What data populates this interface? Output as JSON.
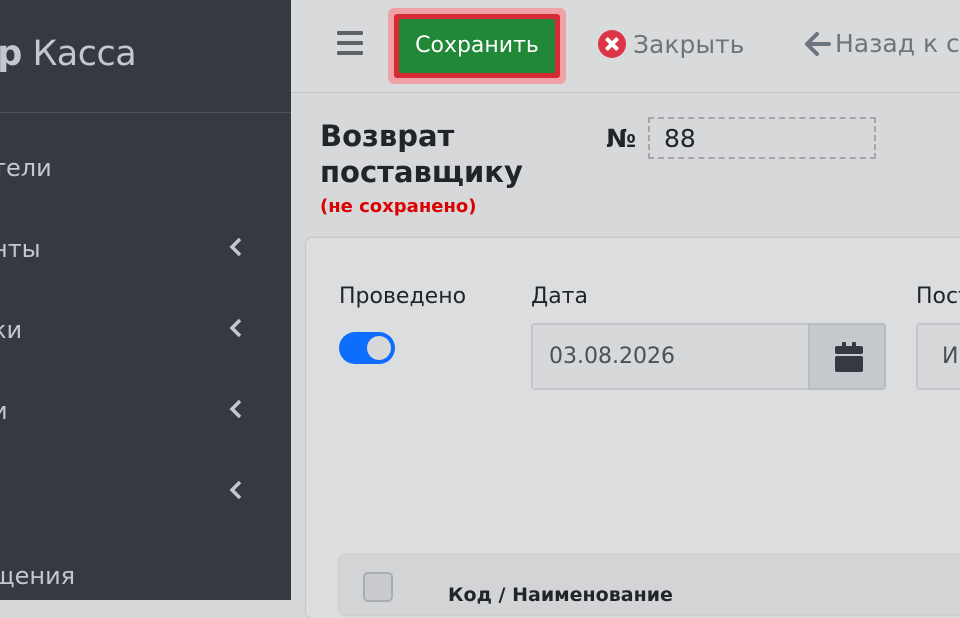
{
  "sidebar": {
    "brand_bold": "ер",
    "brand_light": "Касса",
    "items": [
      {
        "label": "тели",
        "has_arrow": false
      },
      {
        "label": "нты",
        "has_arrow": true
      },
      {
        "label": "ки",
        "has_arrow": true
      },
      {
        "label": "и",
        "has_arrow": true
      },
      {
        "label": "",
        "has_arrow": true
      },
      {
        "label": "щения",
        "has_arrow": false
      }
    ]
  },
  "toolbar": {
    "menu_icon": "hamburger-icon",
    "save_label": "Сохранить",
    "close_label": "Закрыть",
    "close_icon": "close-circle-icon",
    "back_label": "Назад к сп",
    "back_icon": "arrow-left-icon"
  },
  "document": {
    "title": "Возврат поставщику",
    "unsaved": "(не сохранено)",
    "number_label": "№",
    "number_value": "88"
  },
  "form": {
    "posted_label": "Проведено",
    "posted_on": true,
    "date_label": "Дата",
    "date_value": "03.08.2026",
    "calendar_icon": "calendar-icon",
    "supplier_label": "Пост",
    "supplier_value": "И"
  },
  "table": {
    "code_header": "Код / Наименование"
  },
  "colors": {
    "sidebar": "#343a40",
    "save": "#218838",
    "close": "#dc3545",
    "toggle": "#0d6efd",
    "unsaved": "#dc0000"
  }
}
